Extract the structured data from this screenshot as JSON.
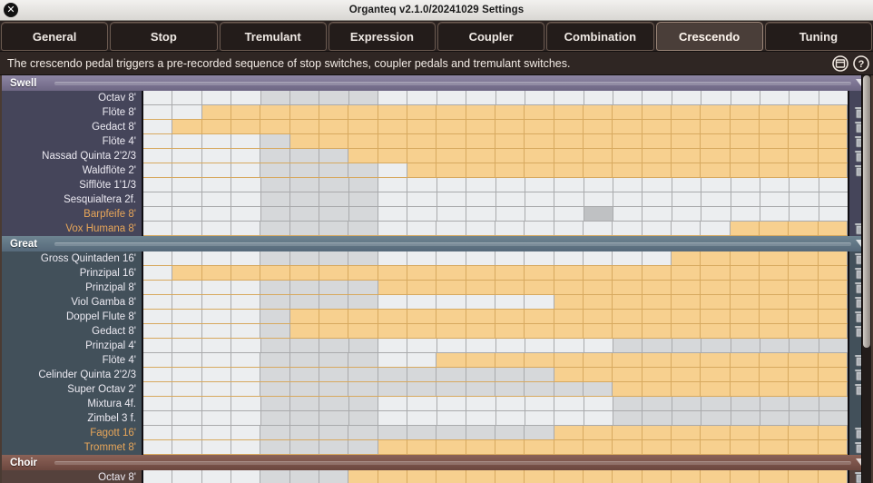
{
  "window": {
    "title": "Organteq v2.1.0/20241029 Settings",
    "close_label": "✕"
  },
  "tabs": [
    {
      "label": "General",
      "active": false
    },
    {
      "label": "Stop",
      "active": false
    },
    {
      "label": "Tremulant",
      "active": false
    },
    {
      "label": "Expression",
      "active": false
    },
    {
      "label": "Coupler",
      "active": false
    },
    {
      "label": "Combination",
      "active": false
    },
    {
      "label": "Crescendo",
      "active": true
    },
    {
      "label": "Tuning",
      "active": false
    }
  ],
  "description": {
    "text": "The crescendo pedal triggers a pre-recorded sequence of stop switches, coupler pedals and tremulant switches.",
    "panel_icon": "window-icon",
    "help_icon": "help-icon"
  },
  "colors": {
    "active_cell": "#f7d08f",
    "swell_header": "#8e86a4",
    "great_header": "#6e8491",
    "choir_header": "#8b6257",
    "reed_label": "#e8a659"
  },
  "grid": {
    "columns": 24,
    "row_icon": "trash-icon"
  },
  "sections": [
    {
      "name": "Swell",
      "theme": "swell",
      "rows": [
        {
          "label": "Octav 8'",
          "reed": false,
          "start": null,
          "shade_from": 4,
          "shade_to": 7
        },
        {
          "label": "Flöte 8'",
          "reed": false,
          "start": 2,
          "shade_from": 4,
          "shade_to": 7
        },
        {
          "label": "Gedact 8'",
          "reed": false,
          "start": 1,
          "shade_from": 4,
          "shade_to": 7
        },
        {
          "label": "Flöte 4'",
          "reed": false,
          "start": 5,
          "shade_from": 4,
          "shade_to": 7
        },
        {
          "label": "Nassad Quinta 2'2/3",
          "reed": false,
          "start": 7,
          "shade_from": 4,
          "shade_to": 7
        },
        {
          "label": "Waldflöte 2'",
          "reed": false,
          "start": 9,
          "shade_from": 4,
          "shade_to": 7
        },
        {
          "label": "Sifflöte 1'1/3",
          "reed": false,
          "start": null,
          "shade_from": 4,
          "shade_to": 7
        },
        {
          "label": "Sesquialtera 2f.",
          "reed": false,
          "start": null,
          "shade_from": 4,
          "shade_to": 7
        },
        {
          "label": "Barpfeife 8'",
          "reed": true,
          "start": null,
          "shade_from": 4,
          "shade_to": 7,
          "dark_cell": 15
        },
        {
          "label": "Vox Humana 8'",
          "reed": true,
          "start": 20,
          "shade_from": 4,
          "shade_to": 7
        }
      ]
    },
    {
      "name": "Great",
      "theme": "great",
      "rows": [
        {
          "label": "Gross Quintaden 16'",
          "reed": false,
          "start": 18,
          "shade_from": 4,
          "shade_to": 7
        },
        {
          "label": "Prinzipal 16'",
          "reed": false,
          "start": 1,
          "shade_from": 4,
          "shade_to": 7
        },
        {
          "label": "Prinzipal 8'",
          "reed": false,
          "start": 8,
          "shade_from": 4,
          "shade_to": 7
        },
        {
          "label": "Viol Gamba 8'",
          "reed": false,
          "start": 14,
          "shade_from": 4,
          "shade_to": 7
        },
        {
          "label": "Doppel Flute 8'",
          "reed": false,
          "start": 5,
          "shade_from": 4,
          "shade_to": 7
        },
        {
          "label": "Gedact 8'",
          "reed": false,
          "start": 5,
          "shade_from": 4,
          "shade_to": 7
        },
        {
          "label": "Prinzipal 4'",
          "reed": false,
          "start": null,
          "shade_from": 4,
          "shade_to": 7,
          "shade2_from": 16,
          "shade2_to": 23
        },
        {
          "label": "Flöte 4'",
          "reed": false,
          "start": 10,
          "shade_from": 4,
          "shade_to": 7
        },
        {
          "label": "Celinder Quinta 2'2/3",
          "reed": false,
          "start": 14,
          "shade_from": 4,
          "shade_to": 13
        },
        {
          "label": "Super Octav 2'",
          "reed": false,
          "start": 16,
          "shade_from": 4,
          "shade_to": 15
        },
        {
          "label": "Mixtura 4f.",
          "reed": false,
          "start": null,
          "shade_from": 4,
          "shade_to": 7,
          "shade2_from": 16,
          "shade2_to": 23
        },
        {
          "label": "Zimbel 3 f.",
          "reed": false,
          "start": null,
          "shade_from": 4,
          "shade_to": 7,
          "shade2_from": 16,
          "shade2_to": 23
        },
        {
          "label": "Fagott 16'",
          "reed": true,
          "start": 14,
          "shade_from": 4,
          "shade_to": 13
        },
        {
          "label": "Trommet 8'",
          "reed": true,
          "start": 8,
          "shade_from": 4,
          "shade_to": 7
        }
      ]
    },
    {
      "name": "Choir",
      "theme": "choir",
      "rows": [
        {
          "label": "Octav 8'",
          "reed": false,
          "start": 7,
          "shade_from": 4,
          "shade_to": 6
        }
      ]
    }
  ]
}
